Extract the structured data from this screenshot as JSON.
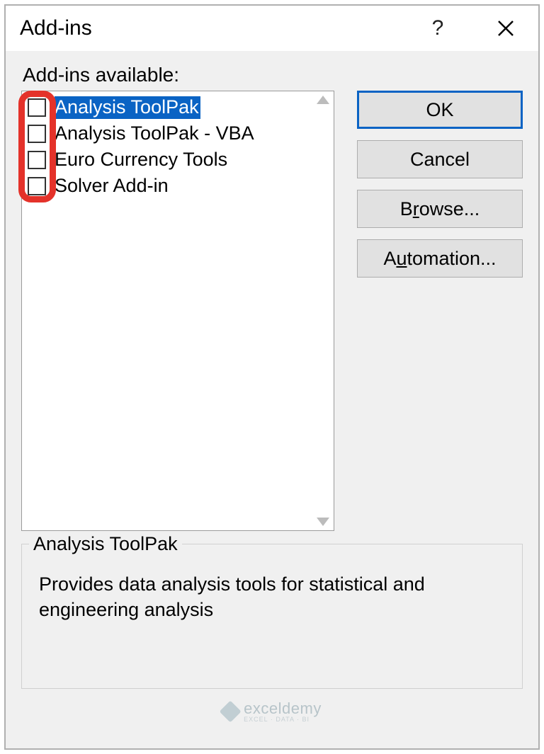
{
  "dialog": {
    "title": "Add-ins",
    "available_label": "Add-ins available:"
  },
  "list": {
    "items": [
      {
        "label": "Analysis ToolPak",
        "checked": false,
        "selected": true
      },
      {
        "label": "Analysis ToolPak - VBA",
        "checked": false,
        "selected": false
      },
      {
        "label": "Euro Currency Tools",
        "checked": false,
        "selected": false
      },
      {
        "label": "Solver Add-in",
        "checked": false,
        "selected": false
      }
    ]
  },
  "buttons": {
    "ok": "OK",
    "cancel": "Cancel",
    "browse_pre": "B",
    "browse_u": "r",
    "browse_post": "owse...",
    "auto_pre": "A",
    "auto_u": "u",
    "auto_post": "tomation..."
  },
  "details": {
    "legend": "Analysis ToolPak",
    "description": "Provides data analysis tools for statistical and engineering analysis"
  },
  "watermark": {
    "brand": "exceldemy",
    "tag": "EXCEL · DATA · BI"
  }
}
